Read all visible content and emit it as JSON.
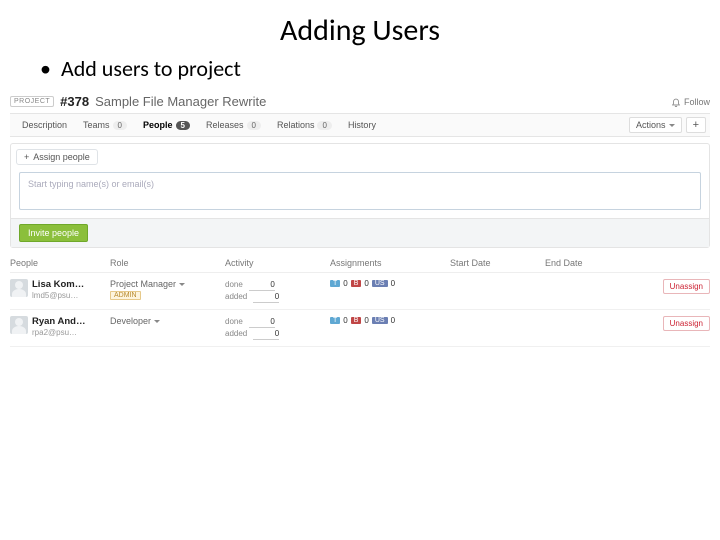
{
  "slide": {
    "title": "Adding Users",
    "bullet": "Add users to project"
  },
  "header": {
    "project_tag": "PROJECT",
    "id": "#378",
    "title": "Sample File Manager Rewrite",
    "follow": "Follow"
  },
  "tabs": [
    {
      "label": "Description",
      "count": null
    },
    {
      "label": "Teams",
      "count": "0"
    },
    {
      "label": "People",
      "count": "5",
      "active": true
    },
    {
      "label": "Releases",
      "count": "0"
    },
    {
      "label": "Relations",
      "count": "0"
    },
    {
      "label": "History",
      "count": null
    }
  ],
  "tabs_right": {
    "actions": "Actions",
    "plus": "+"
  },
  "assign_panel": {
    "pill": "Assign people",
    "placeholder": "Start typing name(s) or email(s)",
    "invite": "Invite people"
  },
  "columns": {
    "people": "People",
    "role": "Role",
    "activity": "Activity",
    "assignments": "Assignments",
    "start": "Start Date",
    "end": "End Date"
  },
  "rows": [
    {
      "name": "Lisa Kom…",
      "email": "lmd5@psu…",
      "role": "Project Manager",
      "admin": "ADMIN",
      "activity": {
        "done_label": "done",
        "done": "0",
        "added_label": "added",
        "added": "0"
      },
      "asg": {
        "T": "0",
        "B": "0",
        "US": "0"
      },
      "unassign": "Unassign"
    },
    {
      "name": "Ryan And…",
      "email": "rpa2@psu…",
      "role": "Developer",
      "admin": null,
      "activity": {
        "done_label": "done",
        "done": "0",
        "added_label": "added",
        "added": "0"
      },
      "asg": {
        "T": "0",
        "B": "0",
        "US": "0"
      },
      "unassign": "Unassign"
    }
  ],
  "tag_labels": {
    "T": "T",
    "B": "B",
    "US": "US"
  }
}
